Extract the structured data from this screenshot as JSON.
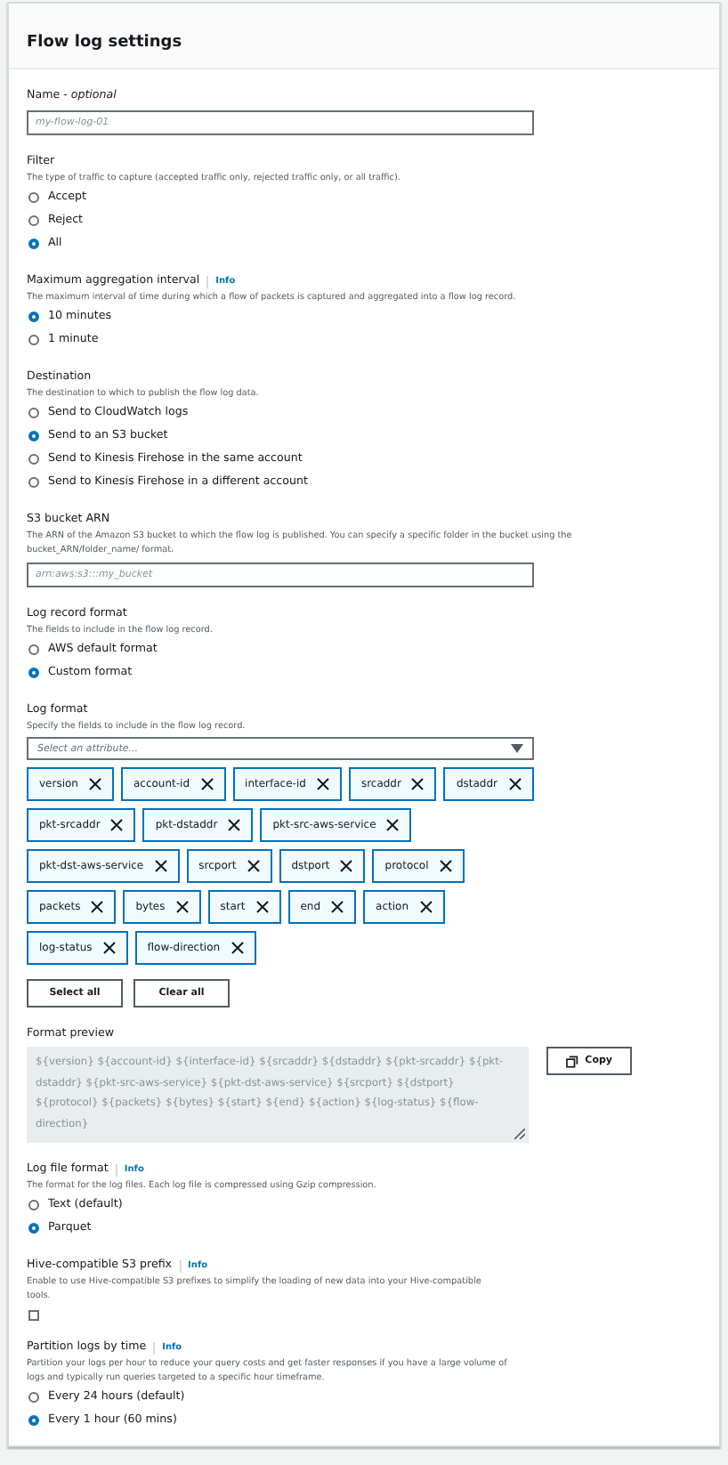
{
  "title": "Flow log settings",
  "sections": [
    {
      "kind": "text_input",
      "label": "Name - *optional*",
      "placeholder": "my-flow-log-01"
    },
    {
      "kind": "radio",
      "label": "Filter",
      "description": "The type of traffic to capture (accepted traffic only, rejected traffic only, or all traffic).",
      "options": [
        {
          "label": "Accept",
          "selected": false
        },
        {
          "label": "Reject",
          "selected": false
        },
        {
          "label": "All",
          "selected": true
        }
      ]
    },
    {
      "kind": "radio",
      "label": "Maximum aggregation interval",
      "info": "Info",
      "description": "The maximum interval of time during which a flow of packets is captured and aggregated into a flow log record.",
      "options": [
        {
          "label": "10 minutes",
          "selected": true
        },
        {
          "label": "1 minute",
          "selected": false
        }
      ]
    },
    {
      "kind": "radio",
      "label": "Destination",
      "description": "The destination to which to publish the flow log data.",
      "options": [
        {
          "label": "Send to CloudWatch logs",
          "selected": false
        },
        {
          "label": "Send to an S3 bucket",
          "selected": true
        },
        {
          "label": "Send to Kinesis Firehose in the same account",
          "selected": false
        },
        {
          "label": "Send to Kinesis Firehose in a different account",
          "selected": false
        }
      ]
    },
    {
      "kind": "text_input",
      "label": "S3 bucket ARN",
      "description": "The ARN of the Amazon S3 bucket to which the flow log is published. You can specify a specific folder in the bucket using the bucket_ARN/folder_name/ format.",
      "placeholder": "arn:aws:s3:::my_bucket"
    },
    {
      "kind": "radio",
      "label": "Log record format",
      "description": "The fields to include in the flow log record.",
      "options": [
        {
          "label": "AWS default format",
          "selected": false
        },
        {
          "label": "Custom format",
          "selected": true
        }
      ]
    },
    {
      "kind": "tags",
      "label": "Log format",
      "description": "Specify the fields to include in the flow log record.",
      "placeholder": "Select an attribute...",
      "tags": [
        "version",
        "account-id",
        "interface-id",
        "srcaddr",
        "dstaddr",
        "pkt-srcaddr",
        "pkt-dstaddr",
        "pkt-src-aws-service",
        "pkt-dst-aws-service",
        "srcport",
        "dstport",
        "protocol",
        "packets",
        "bytes",
        "start",
        "end",
        "action",
        "log-status",
        "flow-direction"
      ],
      "buttons": [
        "Select all",
        "Clear all"
      ]
    },
    {
      "kind": "preview",
      "label": "Format preview",
      "value": "${version} ${account-id} ${interface-id} ${srcaddr} ${dstaddr} ${pkt-srcaddr} ${pkt-dstaddr} ${pkt-src-aws-service} ${pkt-dst-aws-service} ${srcport} ${dstport} ${protocol} ${packets} ${bytes} ${start} ${end} ${action} ${log-status} ${flow-direction}",
      "button": "Copy"
    },
    {
      "kind": "radio",
      "label": "Log file format",
      "info": "Info",
      "description": "The format for the log files. Each log file is compressed using Gzip compression.",
      "options": [
        {
          "label": "Text (default)",
          "selected": false
        },
        {
          "label": "Parquet",
          "selected": true
        }
      ]
    },
    {
      "kind": "checkbox",
      "label": "Hive-compatible S3 prefix",
      "info": "Info",
      "description": "Enable to use Hive-compatible S3 prefixes to simplify the loading of new data into your Hive-compatible tools.",
      "checked": false
    },
    {
      "kind": "radio",
      "label": "Partition logs by time",
      "info": "Info",
      "description": "Partition your logs per hour to reduce your query costs and get faster responses if you have a large volume of logs and typically run queries targeted to a specific hour timeframe.",
      "options": [
        {
          "label": "Every 24 hours (default)",
          "selected": false
        },
        {
          "label": "Every 1 hour (60 mins)",
          "selected": true
        }
      ]
    }
  ]
}
